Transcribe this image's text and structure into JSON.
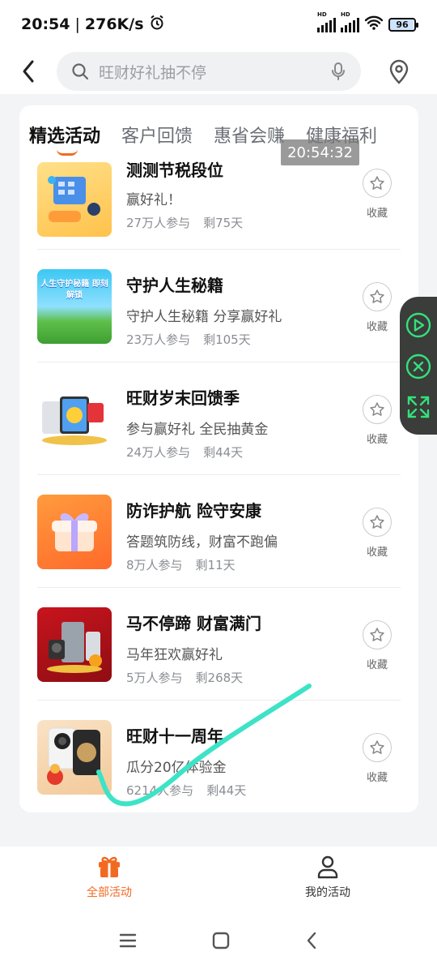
{
  "status": {
    "time": "20:54",
    "speed": "276K/s",
    "battery": "96"
  },
  "header": {
    "search_placeholder": "旺财好礼抽不停"
  },
  "tabs": [
    {
      "label": "精选活动",
      "active": true
    },
    {
      "label": "客户回馈",
      "active": false
    },
    {
      "label": "惠省会赚",
      "active": false
    },
    {
      "label": "健康福利",
      "active": false
    }
  ],
  "time_overlay": "20:54:32",
  "items": [
    {
      "title": "测测节税段位",
      "sub": "赢好礼！",
      "participants": "27万人参与",
      "remaining": "剩75天",
      "fav": "收藏"
    },
    {
      "title": "守护人生秘籍",
      "sub": "守护人生秘籍 分享赢好礼",
      "participants": "23万人参与",
      "remaining": "剩105天",
      "fav": "收藏",
      "thumb_text": "人生守护秘籍 即刻解锁"
    },
    {
      "title": "旺财岁末回馈季",
      "sub": "参与赢好礼 全民抽黄金",
      "participants": "24万人参与",
      "remaining": "剩44天",
      "fav": "收藏"
    },
    {
      "title": "防诈护航 险守安康",
      "sub": "答题筑防线，财富不跑偏",
      "participants": "8万人参与",
      "remaining": "剩11天",
      "fav": "收藏"
    },
    {
      "title": "马不停蹄 财富满门",
      "sub": "马年狂欢赢好礼",
      "participants": "5万人参与",
      "remaining": "剩268天",
      "fav": "收藏"
    },
    {
      "title": "旺财十一周年",
      "sub": "瓜分20亿体验金",
      "participants": "6214人参与",
      "remaining": "剩44天",
      "fav": "收藏"
    }
  ],
  "bottom_nav": {
    "all": "全部活动",
    "mine": "我的活动"
  },
  "colors": {
    "accent": "#f26a21",
    "stroke": "#3de3c6"
  }
}
